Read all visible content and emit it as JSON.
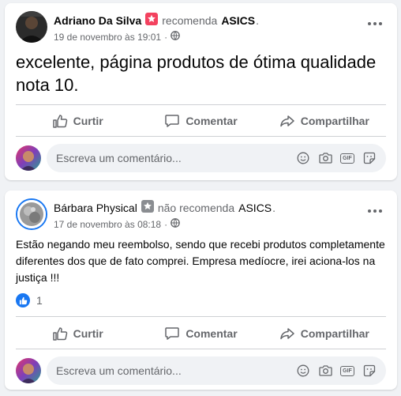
{
  "posts": [
    {
      "author": "Adriano Da Silva",
      "verb": "recomenda",
      "page": "ASICS",
      "date": "19 de novembro às 19:01",
      "text": "excelente, página produtos de ótima qualidade nota 10.",
      "recommend_badge": "recommend-star",
      "like_count": null
    },
    {
      "author": "Bárbara Physical",
      "verb": "não recomenda",
      "page": "ASICS",
      "date": "17 de novembro às 08:18",
      "text": "Estão negando meu reembolso, sendo que recebi produtos completamente diferentes dos que de fato comprei. Empresa medíocre, irei aciona-los na justiça !!!",
      "recommend_badge": "not-recommend-star",
      "like_count": "1"
    }
  ],
  "actions": {
    "like_label": "Curtir",
    "comment_label": "Comentar",
    "share_label": "Compartilhar"
  },
  "comment_placeholder": "Escreva um comentário...",
  "colors": {
    "recommend": "#f3425f",
    "not_recommend": "#8a8d91",
    "like_blue": "#1877f2",
    "muted": "#65676b"
  }
}
